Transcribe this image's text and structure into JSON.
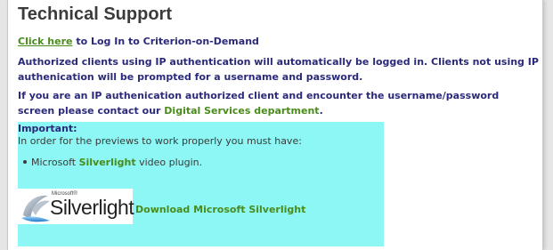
{
  "page": {
    "title": "Technical Support"
  },
  "login_line": {
    "link_text": "Click here",
    "rest_text": "to Log In to Criterion-on-Demand"
  },
  "ip_auth_text": "Authorized clients using IP authentication will automatically be logged in. Clients not using IP authenication will be prompted for a username and password.",
  "contact_line": {
    "text_before": "If you are an IP authenication authorized client and encounter the username/password screen please contact our",
    "link_text": "Digital Services department",
    "text_after": "."
  },
  "important_box": {
    "title": "Important:",
    "intro": "In order for the previews to work properly you must have:",
    "bullet": {
      "prefix": "Microsoft",
      "highlight": "Silverlight",
      "suffix": "video plugin."
    },
    "logo": {
      "small_text": "Microsoft®",
      "big_text": "Silverlight",
      "icon": "silverlight-logo-icon"
    },
    "download_link": "Download Microsoft Silverlight"
  },
  "colors": {
    "heading": "#3b3b3b",
    "text_navy": "#2b2a7a",
    "link_green": "#4a8c1c",
    "box_cyan": "#8cf7f4"
  }
}
